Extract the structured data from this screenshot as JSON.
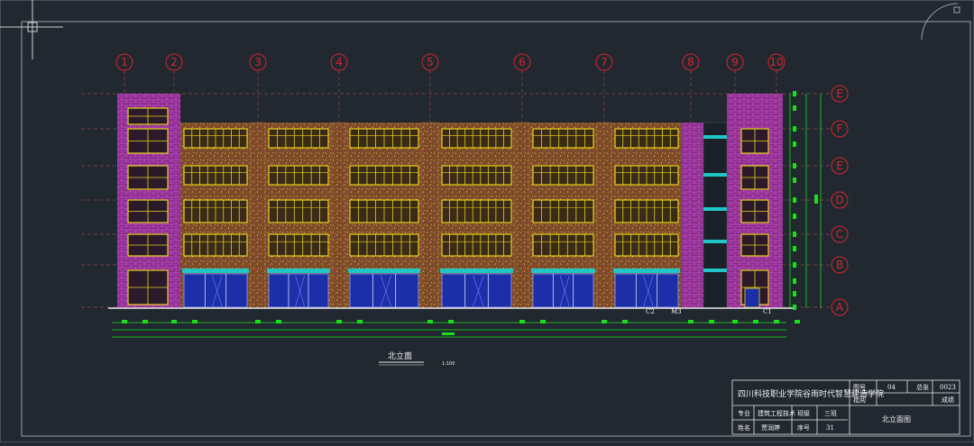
{
  "colors": {
    "background": "#212830",
    "grid_bubble": "#d8252a",
    "stair_brick": "#8c2f8e",
    "wall_texture": "#7a4a2b",
    "window": "#e6d21a",
    "awning": "#20c6c6",
    "glazing": "#1d2fa8",
    "dimension": "#18e01a",
    "frame": "#e8e8e8"
  },
  "drawing": {
    "grid_axes": [
      "1",
      "2",
      "3",
      "4",
      "5",
      "6",
      "7",
      "8",
      "9",
      "10"
    ],
    "level_axes": [
      "E",
      "F",
      "E",
      "D",
      "C",
      "B",
      "A"
    ],
    "door_tags": [
      "C2",
      "M3",
      "C1"
    ],
    "caption": "北立面",
    "scale": "1:100"
  },
  "title_block": {
    "school": "四川科技职业学院谷雨时代智慧建造学院",
    "label_figure_no": "图号",
    "figure_no": "04",
    "label_total": "总张",
    "total": "0023",
    "label_approve": "批阅",
    "grade": "成绩",
    "label_major": "专业",
    "major": "建筑工程技术",
    "label_class": "班级",
    "class_value": "三班",
    "label_name": "姓名",
    "name": "贾润婷",
    "label_seq": "序号",
    "seq": "31",
    "sheet_title": "北立面图"
  }
}
